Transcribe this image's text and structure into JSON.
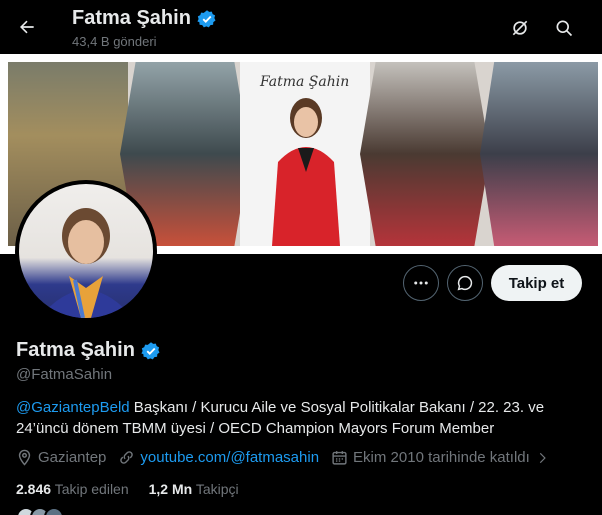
{
  "header": {
    "name": "Fatma Şahin",
    "posts_count": "43,4 B gönderi",
    "icons": [
      "arrow-left-icon",
      "lock-slash-icon",
      "search-icon"
    ]
  },
  "banner": {
    "signature": "Fatma Şahin"
  },
  "actions": {
    "more_icon": "ellipsis-icon",
    "message_icon": "message-icon",
    "follow_label": "Takip et"
  },
  "profile": {
    "name": "Fatma Şahin",
    "handle": "@FatmaSahin",
    "verified_icon": "verified-badge-icon",
    "bio_mention": "@GaziantepBeld",
    "bio_text": " Başkanı / Kurucu Aile ve Sosyal Politikalar Bakanı / 22. 23. ve 24’üncü dönem TBMM üyesi / OECD Champion Mayors Forum Member",
    "location": "Gaziantep",
    "website": "youtube.com/@fatmasahin",
    "joined": "Ekim 2010 tarihinde katıldı"
  },
  "stats": {
    "following_count": "2.846",
    "following_label": "Takip edilen",
    "followers_count": "1,2 Mn",
    "followers_label": "Takipçi"
  },
  "colors": {
    "accent": "#1d9bf0",
    "background": "#000000",
    "text": "#e7e9ea",
    "muted": "#71767b",
    "follow_button_bg": "#eff3f4"
  }
}
